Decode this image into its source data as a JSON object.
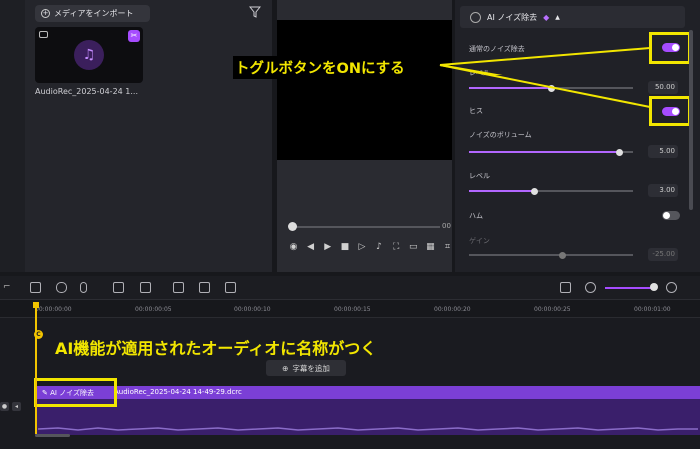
{
  "media": {
    "import_label": "メディアをインポート",
    "file_name": "AudioRec_2025-04-24 1..."
  },
  "player": {
    "time_end": "00"
  },
  "ai_panel": {
    "title": "AI ノイズ除去",
    "normal_noise_label": "通常のノイズ除去",
    "level_label_1": "レベル",
    "level_value_1": "50.00",
    "hiss_label": "ヒス",
    "noise_volume_label": "ノイズのボリューム",
    "noise_volume_value": "5.00",
    "level_label_2": "レベル",
    "level_value_2": "3.00",
    "hum_label": "ハム",
    "gain_label": "ゲイン",
    "gain_value": "-25.00",
    "toggles": {
      "normal_noise": true,
      "hiss": true,
      "hum": false
    },
    "sliders": {
      "level_1": 0.5,
      "noise_volume": 0.92,
      "level_2": 0.4,
      "gain": 0.57
    }
  },
  "annotations": {
    "toggle_hint": "トグルボタンをONにする",
    "clip_name_hint": "AI機能が適用されたオーディオに名称がつく"
  },
  "timeline": {
    "ticks": [
      "00:00:00:00",
      "00:00:00:05",
      "00:00:00:10",
      "00:00:00:15",
      "00:00:00:20",
      "00:00:00:25",
      "00:00:01:00"
    ],
    "subtitle_button": "字幕を追加",
    "clip_effect_label": "AI ノイズ除去",
    "clip_name": "AudioRec_2025-04-24 14-49-29.dcrc"
  },
  "colors": {
    "accent": "#a64cff",
    "highlight": "#f2e600",
    "playhead": "#f2c400"
  }
}
